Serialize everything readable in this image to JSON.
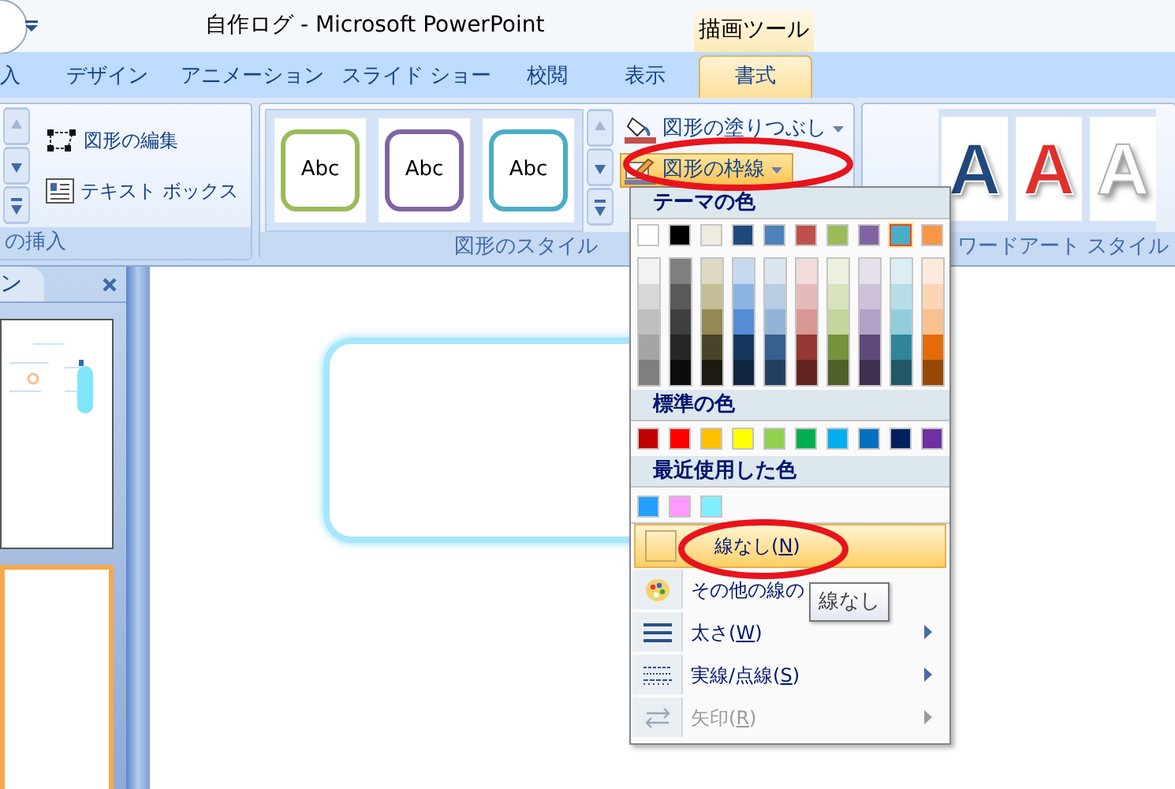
{
  "title_bar": {
    "title": "自作ログ - Microsoft PowerPoint",
    "context_label": "描画ツール"
  },
  "tabs": [
    {
      "label": "入",
      "selected": false
    },
    {
      "label": "デザイン",
      "selected": false
    },
    {
      "label": "アニメーション",
      "selected": false
    },
    {
      "label": "スライド ショー",
      "selected": false
    },
    {
      "label": "校閲",
      "selected": false
    },
    {
      "label": "表示",
      "selected": false
    },
    {
      "label": "書式",
      "selected": true
    }
  ],
  "ribbon": {
    "insert_group": {
      "buttons": [
        "図形の編集",
        "テキスト ボックス"
      ],
      "label": "の挿入"
    },
    "styles_group": {
      "styles": [
        {
          "label": "Abc",
          "color": "#9bbb59"
        },
        {
          "label": "Abc",
          "color": "#8064a2"
        },
        {
          "label": "Abc",
          "color": "#4bacc6"
        }
      ],
      "fill_button": {
        "label": "図形の塗りつぶし",
        "open": false
      },
      "outline_button": {
        "label": "図形の枠線",
        "open": true
      },
      "label": "図形のスタイル"
    },
    "wordart_group": {
      "samples": [
        {
          "letter": "A",
          "kind": "outline",
          "color": "#1f497d"
        },
        {
          "letter": "A",
          "kind": "outline",
          "color": "#e0302b"
        },
        {
          "letter": "A",
          "kind": "shadow",
          "color": "#ffffff"
        }
      ],
      "label": "ワードアート スタイル"
    }
  },
  "slides_panel": {
    "tab_label": "ン",
    "slides": [
      {
        "kind": "diagram",
        "selected": false
      },
      {
        "kind": "blank",
        "selected": true
      }
    ]
  },
  "outline_menu": {
    "theme_header": "テーマの色",
    "theme_colors": [
      {
        "color": "#ffffff",
        "selected": false
      },
      {
        "color": "#000000",
        "selected": false
      },
      {
        "color": "#eeece1",
        "selected": false
      },
      {
        "color": "#1f497d",
        "selected": false
      },
      {
        "color": "#4f81bd",
        "selected": false
      },
      {
        "color": "#c0504d",
        "selected": false
      },
      {
        "color": "#9bbb59",
        "selected": false
      },
      {
        "color": "#8064a2",
        "selected": false
      },
      {
        "color": "#4bacc6",
        "selected": true
      },
      {
        "color": "#f79646",
        "selected": false
      }
    ],
    "shade_columns": [
      {
        "swatches": [
          {
            "color": "#f2f2f2"
          },
          {
            "color": "#d8d8d8"
          },
          {
            "color": "#bfbfbf"
          },
          {
            "color": "#a5a5a5"
          },
          {
            "color": "#7f7f7f"
          }
        ]
      },
      {
        "swatches": [
          {
            "color": "#7f7f7f"
          },
          {
            "color": "#595959"
          },
          {
            "color": "#3f3f3f"
          },
          {
            "color": "#262626"
          },
          {
            "color": "#0c0c0c"
          }
        ]
      },
      {
        "swatches": [
          {
            "color": "#ddd9c3"
          },
          {
            "color": "#c4bd97"
          },
          {
            "color": "#938953"
          },
          {
            "color": "#494429"
          },
          {
            "color": "#1d1b10"
          }
        ]
      },
      {
        "swatches": [
          {
            "color": "#c6d9f0"
          },
          {
            "color": "#8db3e2"
          },
          {
            "color": "#548dd4"
          },
          {
            "color": "#17365d"
          },
          {
            "color": "#0f243e"
          }
        ]
      },
      {
        "swatches": [
          {
            "color": "#dbe5f1"
          },
          {
            "color": "#b8cce4"
          },
          {
            "color": "#95b3d7"
          },
          {
            "color": "#366092"
          },
          {
            "color": "#244061"
          }
        ]
      },
      {
        "swatches": [
          {
            "color": "#f2dcdb"
          },
          {
            "color": "#e5b9b7"
          },
          {
            "color": "#d99694"
          },
          {
            "color": "#953734"
          },
          {
            "color": "#632423"
          }
        ]
      },
      {
        "swatches": [
          {
            "color": "#ebf1dd"
          },
          {
            "color": "#d7e3bc"
          },
          {
            "color": "#c3d69b"
          },
          {
            "color": "#76923c"
          },
          {
            "color": "#4f6128"
          }
        ]
      },
      {
        "swatches": [
          {
            "color": "#e5e0ec"
          },
          {
            "color": "#ccc1d9"
          },
          {
            "color": "#b2a2c7"
          },
          {
            "color": "#5f497a"
          },
          {
            "color": "#3f3151"
          }
        ]
      },
      {
        "swatches": [
          {
            "color": "#dbeef3"
          },
          {
            "color": "#b7dde8"
          },
          {
            "color": "#92cddc"
          },
          {
            "color": "#31859b"
          },
          {
            "color": "#205867"
          }
        ]
      },
      {
        "swatches": [
          {
            "color": "#fdeada"
          },
          {
            "color": "#fbd5b5"
          },
          {
            "color": "#fac08f"
          },
          {
            "color": "#e36c09"
          },
          {
            "color": "#974806"
          }
        ]
      }
    ],
    "standard_header": "標準の色",
    "standard_colors": [
      {
        "color": "#c00000"
      },
      {
        "color": "#ff0000"
      },
      {
        "color": "#ffc000"
      },
      {
        "color": "#ffff00"
      },
      {
        "color": "#92d050"
      },
      {
        "color": "#00b050"
      },
      {
        "color": "#00b0f0"
      },
      {
        "color": "#0070c0"
      },
      {
        "color": "#002060"
      },
      {
        "color": "#7030a0"
      }
    ],
    "recent_header": "最近使用した色",
    "recent_colors": [
      {
        "color": "#21a0ff"
      },
      {
        "color": "#ff99ff"
      },
      {
        "color": "#80eeff"
      }
    ],
    "items": [
      {
        "kind": "no-line",
        "label": "線なし(",
        "accelerator": "N",
        "label_end": ")",
        "highlighted": true,
        "disabled": false,
        "submenu": false
      },
      {
        "kind": "palette",
        "label": "その他の線の",
        "highlighted": false,
        "disabled": false,
        "submenu": false
      },
      {
        "kind": "weight",
        "label": "太さ(",
        "accelerator": "W",
        "label_end": ")",
        "highlighted": false,
        "disabled": false,
        "submenu": true
      },
      {
        "kind": "dash",
        "label": "実線/点線(",
        "accelerator": "S",
        "label_end": ")",
        "highlighted": false,
        "disabled": false,
        "submenu": true
      },
      {
        "kind": "arrow",
        "label": "矢印(",
        "accelerator": "R",
        "label_end": ")",
        "highlighted": false,
        "disabled": true,
        "submenu": true
      }
    ]
  },
  "tooltip": "線なし"
}
